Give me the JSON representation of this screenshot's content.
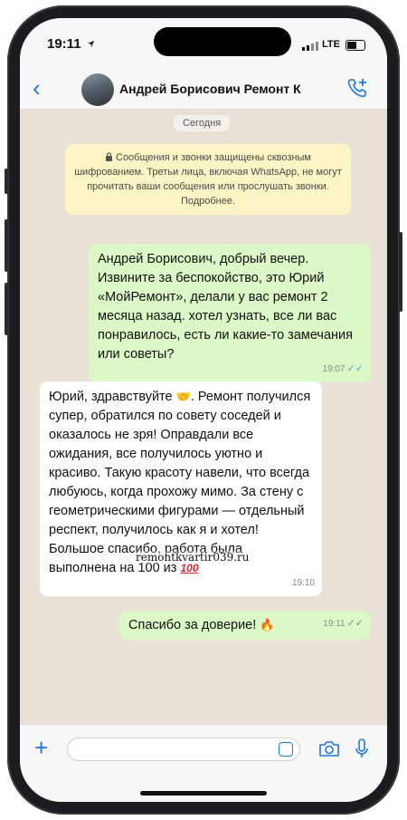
{
  "status": {
    "time": "19:11",
    "network": "LTE",
    "battery_level": 0.6
  },
  "header": {
    "contact_name": "Андрей Борисович Ремонт К"
  },
  "chat": {
    "date_label": "Сегодня",
    "encryption_notice": "Сообщения и звонки защищены сквозным шифрованием. Третьи лица, включая WhatsApp, не могут прочитать ваши сообщения или прослушать звонки. Подробнее.",
    "messages": [
      {
        "direction": "outgoing",
        "text": "Андрей Борисович, добрый вечер. Извините за беспокойство, это Юрий «МойРемонт», делали у вас ремонт 2 месяца назад. хотел узнать, все ли вас понравилось, есть ли какие-то замечания или советы?",
        "time": "19:07",
        "status": "read"
      },
      {
        "direction": "incoming",
        "text_before_emoji": "Юрий, здравствуйте",
        "emoji_handshake": "🤝",
        "text_after_emoji": ". Ремонт получился супер, обратился по совету соседей и оказалось не зря! Оправдали все ожидания, все получилось уютно и красиво. Такую красоту навели, что всегда любуюсь, когда прохожу мимо. За стену с геометрическими фигурами — отдельный респект, получилось как я и хотел! Большое спасибо, работа была выполнена на 100 из",
        "emoji_hundred": "100",
        "time": "19:10"
      },
      {
        "direction": "outgoing",
        "text": "Спасибо за доверие!",
        "emoji_fire": "🔥",
        "time": "19:11",
        "status": "delivered"
      }
    ]
  },
  "watermark": "remontkvartir039.ru",
  "colors": {
    "accent": "#1f7ae0",
    "outgoing_bubble": "#dcf8c6",
    "incoming_bubble": "#ffffff",
    "notice": "#fcf4c5",
    "read_ticks": "#4fa8e0"
  },
  "icons": [
    "back-chevron-icon",
    "add-call-icon",
    "lock-icon",
    "plus-icon",
    "sticker-icon",
    "camera-icon",
    "microphone-icon"
  ]
}
